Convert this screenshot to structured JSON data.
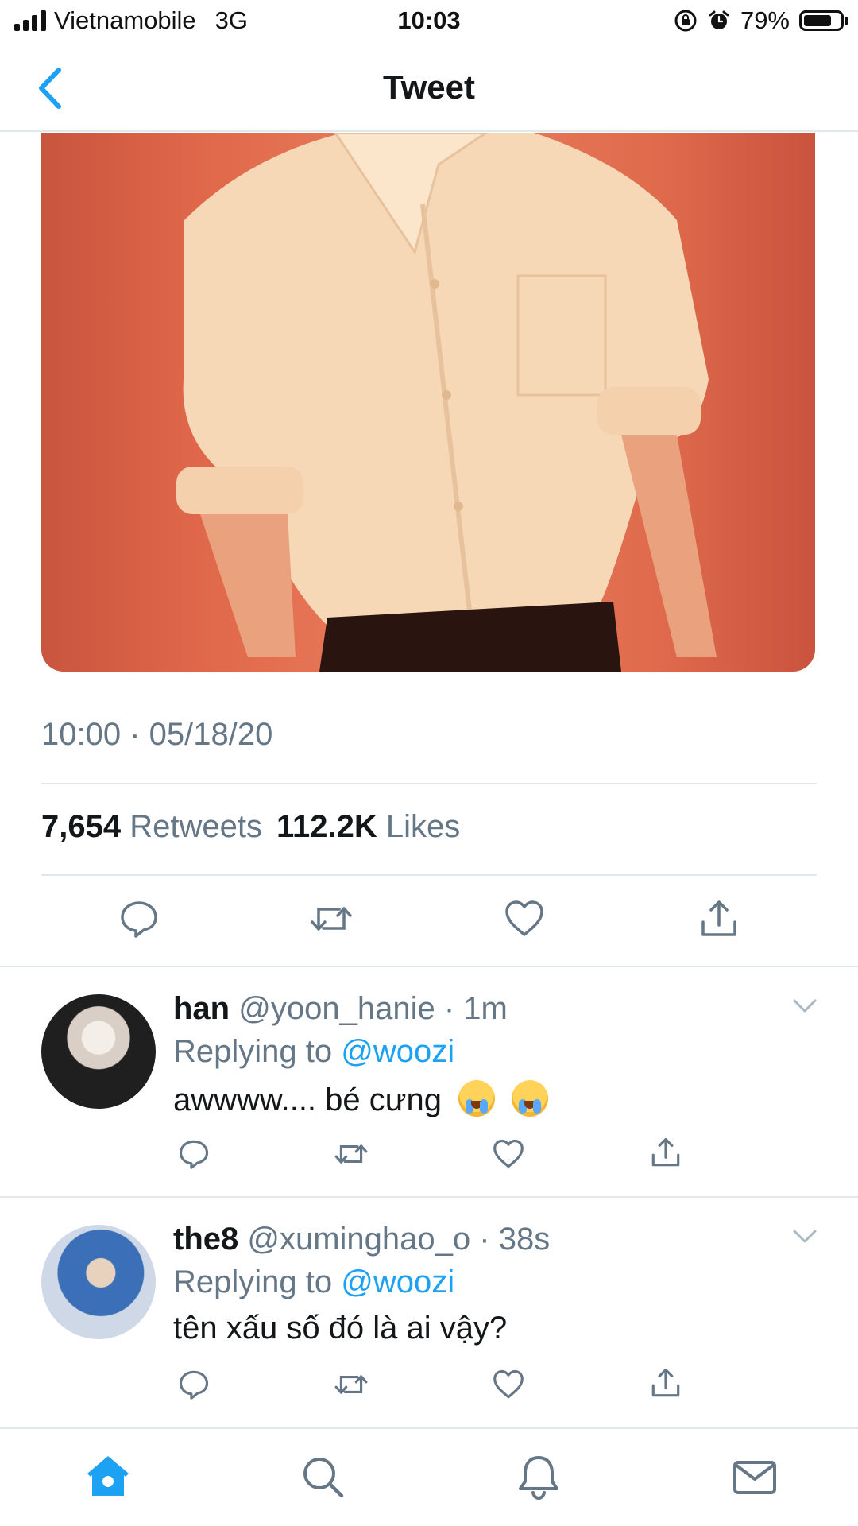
{
  "status_bar": {
    "carrier": "Vietnamobile",
    "network": "3G",
    "time": "10:03",
    "battery": "79%",
    "battery_level": 0.79
  },
  "nav": {
    "title": "Tweet",
    "back_icon": "chevron-left-icon"
  },
  "tweet": {
    "image_description_icon": "photo",
    "timestamp": "10:00 · 05/18/20",
    "retweets_count": "7,654",
    "retweets_label": "Retweets",
    "likes_count": "112.2K",
    "likes_label": "Likes",
    "actions": [
      "reply-icon",
      "retweet-icon",
      "like-icon",
      "share-icon"
    ]
  },
  "replies": [
    {
      "name": "han",
      "handle": "@yoon_hanie",
      "time": "1m",
      "replying_prefix": "Replying to",
      "replying_to": "@woozi",
      "text": "awwww.... bé cưng"
    },
    {
      "name": "the8",
      "handle": "@xuminghao_o",
      "time": "38s",
      "replying_prefix": "Replying to",
      "replying_to": "@woozi",
      "text": "tên xấu số đó là ai vậy?"
    }
  ],
  "tab_bar": {
    "tabs": [
      "home-icon",
      "search-icon",
      "notifications-icon",
      "messages-icon"
    ],
    "active": "home-icon"
  },
  "colors": {
    "accent": "#1da1f2",
    "text": "#14171a",
    "muted": "#657786",
    "divider": "#e1e8ed"
  }
}
